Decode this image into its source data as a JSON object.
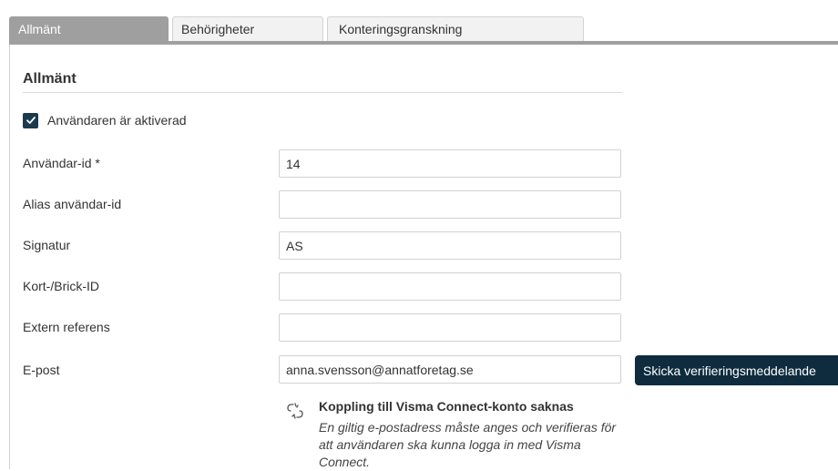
{
  "tabs": [
    {
      "label": "Allmänt",
      "active": true
    },
    {
      "label": "Behörigheter",
      "active": false
    },
    {
      "label": "Konteringsgranskning",
      "active": false
    }
  ],
  "section": {
    "title": "Allmänt"
  },
  "active_checkbox": {
    "label": "Användaren är aktiverad",
    "checked": true
  },
  "fields": {
    "user_id": {
      "label": "Användar-id *",
      "value": "14"
    },
    "alias_id": {
      "label": "Alias användar-id",
      "value": ""
    },
    "signature": {
      "label": "Signatur",
      "value": "AS"
    },
    "card_id": {
      "label": "Kort-/Brick-ID",
      "value": ""
    },
    "external_ref": {
      "label": "Extern referens",
      "value": ""
    },
    "email": {
      "label": "E-post",
      "value": "anna.svensson@annatforetag.se"
    }
  },
  "verify_button": {
    "label": "Skicka verifieringsmeddelande"
  },
  "notice": {
    "icon": "broken-link-icon",
    "title": "Koppling till Visma Connect-konto saknas",
    "body": "En giltig e-postadress måste anges och verifieras för att användaren ska kunna logga in med Visma Connect."
  },
  "colors": {
    "tab_active": "#9f9f9f",
    "checkbox": "#1c3a4b",
    "button": "#0e2c3d"
  }
}
